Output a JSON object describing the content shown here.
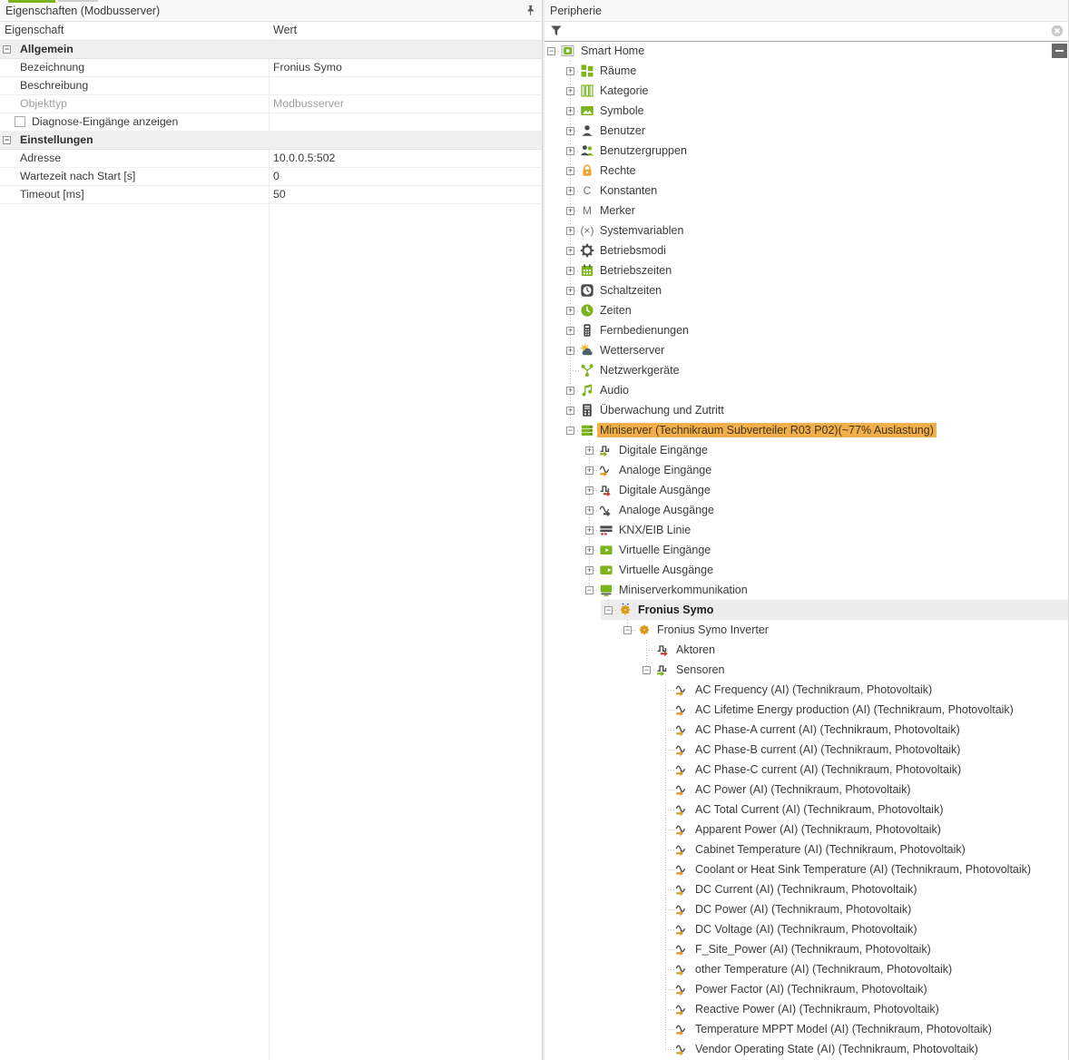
{
  "colors": {
    "accent_green": "#7cb41e",
    "highlight_amber": "#f1af4b",
    "selection_gray": "#ececec",
    "icon_dark": "#4a4a4a",
    "lock_orange": "#f0a232",
    "arrow_red": "#c23b3b",
    "arrow_amber": "#d79a1f"
  },
  "properties_panel": {
    "title": "Eigenschaften (Modbusserver)",
    "pin_icon": "pin-icon",
    "columns": {
      "property": "Eigenschaft",
      "value": "Wert"
    },
    "sections": [
      {
        "label": "Allgemein",
        "rows": [
          {
            "label": "Bezeichnung",
            "value": "Fronius Symo"
          },
          {
            "label": "Beschreibung",
            "value": ""
          },
          {
            "label": "Objekttyp",
            "value": "Modbusserver",
            "grayed": true
          },
          {
            "label": "Diagnose-Eingänge anzeigen",
            "value": "",
            "checkbox": true,
            "checked": false
          }
        ]
      },
      {
        "label": "Einstellungen",
        "rows": [
          {
            "label": "Adresse",
            "value": "10.0.0.5:502"
          },
          {
            "label": "Wartezeit nach Start [s]",
            "value": "0"
          },
          {
            "label": "Timeout [ms]",
            "value": "50"
          }
        ]
      }
    ]
  },
  "peripherie_panel": {
    "title": "Peripherie",
    "filter": {
      "value": "",
      "placeholder": "",
      "funnel_icon": "filter-icon",
      "clear_icon": "clear-icon"
    },
    "collapse_all_button": "minus",
    "tree": [
      {
        "level": 0,
        "expand": "minus",
        "icon": "smart-home-icon",
        "label": "Smart Home"
      },
      {
        "level": 1,
        "expand": "plus",
        "icon": "rooms-icon",
        "label": "Räume"
      },
      {
        "level": 1,
        "expand": "plus",
        "icon": "categories-icon",
        "label": "Kategorie"
      },
      {
        "level": 1,
        "expand": "plus",
        "icon": "symbols-icon",
        "label": "Symbole"
      },
      {
        "level": 1,
        "expand": "plus",
        "icon": "user-icon",
        "label": "Benutzer"
      },
      {
        "level": 1,
        "expand": "plus",
        "icon": "user-group-icon",
        "label": "Benutzergruppen"
      },
      {
        "level": 1,
        "expand": "plus",
        "icon": "lock-icon",
        "label": "Rechte"
      },
      {
        "level": 1,
        "expand": "plus",
        "icon": "constants-icon",
        "label": "Konstanten"
      },
      {
        "level": 1,
        "expand": "plus",
        "icon": "marker-icon",
        "label": "Merker"
      },
      {
        "level": 1,
        "expand": "plus",
        "icon": "system-variables-icon",
        "label": "Systemvariablen"
      },
      {
        "level": 1,
        "expand": "plus",
        "icon": "gear-icon",
        "label": "Betriebsmodi"
      },
      {
        "level": 1,
        "expand": "plus",
        "icon": "calendar-icon",
        "label": "Betriebszeiten"
      },
      {
        "level": 1,
        "expand": "plus",
        "icon": "clock-dark-icon",
        "label": "Schaltzeiten"
      },
      {
        "level": 1,
        "expand": "plus",
        "icon": "clock-green-icon",
        "label": "Zeiten"
      },
      {
        "level": 1,
        "expand": "plus",
        "icon": "remote-icon",
        "label": "Fernbedienungen"
      },
      {
        "level": 1,
        "expand": "plus",
        "icon": "weather-icon",
        "label": "Wetterserver"
      },
      {
        "level": 1,
        "expand": null,
        "icon": "network-icon",
        "label": "Netzwerkgeräte"
      },
      {
        "level": 1,
        "expand": "plus",
        "icon": "audio-icon",
        "label": "Audio"
      },
      {
        "level": 1,
        "expand": "plus",
        "icon": "surveillance-icon",
        "label": "Überwachung und Zutritt"
      },
      {
        "level": 1,
        "expand": "minus",
        "icon": "server-icon",
        "label": "Miniserver (Technikraum Subverteiler R03 P02)(~77% Auslastung)",
        "highlighted": true
      },
      {
        "level": 2,
        "expand": "plus",
        "icon": "digital-input-icon",
        "label": "Digitale Eingänge"
      },
      {
        "level": 2,
        "expand": "plus",
        "icon": "analog-input-icon",
        "label": "Analoge Eingänge"
      },
      {
        "level": 2,
        "expand": "plus",
        "icon": "digital-output-icon",
        "label": "Digitale Ausgänge"
      },
      {
        "level": 2,
        "expand": "plus",
        "icon": "analog-output-icon",
        "label": "Analoge Ausgänge"
      },
      {
        "level": 2,
        "expand": "plus",
        "icon": "knx-icon",
        "label": "KNX/EIB Linie"
      },
      {
        "level": 2,
        "expand": "plus",
        "icon": "virtual-input-icon",
        "label": "Virtuelle Eingänge"
      },
      {
        "level": 2,
        "expand": "plus",
        "icon": "virtual-output-icon",
        "label": "Virtuelle Ausgänge"
      },
      {
        "level": 2,
        "expand": "minus",
        "icon": "monitor-icon",
        "label": "Miniserverkommunikation"
      },
      {
        "level": 3,
        "expand": "minus",
        "icon": "fronius-device-icon",
        "label": "Fronius Symo",
        "bold": true,
        "selected": true
      },
      {
        "level": 4,
        "expand": "minus",
        "icon": "fronius-inverter-icon",
        "label": "Fronius Symo Inverter"
      },
      {
        "level": 5,
        "expand": null,
        "icon": "actuators-icon",
        "label": "Aktoren"
      },
      {
        "level": 5,
        "expand": "minus",
        "icon": "sensors-icon",
        "label": "Sensoren"
      },
      {
        "level": 6,
        "expand": null,
        "icon": "analog-sensor-icon",
        "label": "AC Frequency (AI) (Technikraum, Photovoltaik)"
      },
      {
        "level": 6,
        "expand": null,
        "icon": "analog-sensor-icon",
        "label": "AC Lifetime Energy production (AI) (Technikraum, Photovoltaik)"
      },
      {
        "level": 6,
        "expand": null,
        "icon": "analog-sensor-icon",
        "label": "AC Phase-A current (AI) (Technikraum, Photovoltaik)"
      },
      {
        "level": 6,
        "expand": null,
        "icon": "analog-sensor-icon",
        "label": "AC Phase-B current (AI) (Technikraum, Photovoltaik)"
      },
      {
        "level": 6,
        "expand": null,
        "icon": "analog-sensor-icon",
        "label": "AC Phase-C current (AI) (Technikraum, Photovoltaik)"
      },
      {
        "level": 6,
        "expand": null,
        "icon": "analog-sensor-icon",
        "label": "AC Power (AI) (Technikraum, Photovoltaik)"
      },
      {
        "level": 6,
        "expand": null,
        "icon": "analog-sensor-icon",
        "label": "AC Total Current (AI) (Technikraum, Photovoltaik)"
      },
      {
        "level": 6,
        "expand": null,
        "icon": "analog-sensor-icon",
        "label": "Apparent Power (AI) (Technikraum, Photovoltaik)"
      },
      {
        "level": 6,
        "expand": null,
        "icon": "analog-sensor-icon",
        "label": "Cabinet Temperature (AI) (Technikraum, Photovoltaik)"
      },
      {
        "level": 6,
        "expand": null,
        "icon": "analog-sensor-icon",
        "label": "Coolant or Heat Sink Temperature (AI) (Technikraum, Photovoltaik)"
      },
      {
        "level": 6,
        "expand": null,
        "icon": "analog-sensor-icon",
        "label": "DC Current (AI) (Technikraum, Photovoltaik)"
      },
      {
        "level": 6,
        "expand": null,
        "icon": "analog-sensor-icon",
        "label": "DC Power (AI) (Technikraum, Photovoltaik)"
      },
      {
        "level": 6,
        "expand": null,
        "icon": "analog-sensor-icon",
        "label": "DC Voltage (AI) (Technikraum, Photovoltaik)"
      },
      {
        "level": 6,
        "expand": null,
        "icon": "analog-sensor-icon",
        "label": "F_Site_Power (AI) (Technikraum, Photovoltaik)"
      },
      {
        "level": 6,
        "expand": null,
        "icon": "analog-sensor-icon",
        "label": "other Temperature (AI) (Technikraum, Photovoltaik)"
      },
      {
        "level": 6,
        "expand": null,
        "icon": "analog-sensor-icon",
        "label": "Power Factor (AI) (Technikraum, Photovoltaik)"
      },
      {
        "level": 6,
        "expand": null,
        "icon": "analog-sensor-icon",
        "label": "Reactive Power (AI) (Technikraum, Photovoltaik)"
      },
      {
        "level": 6,
        "expand": null,
        "icon": "analog-sensor-icon",
        "label": "Temperature MPPT Model (AI) (Technikraum, Photovoltaik)"
      },
      {
        "level": 6,
        "expand": null,
        "icon": "analog-sensor-icon",
        "label": "Vendor Operating State (AI) (Technikraum, Photovoltaik)"
      }
    ]
  }
}
